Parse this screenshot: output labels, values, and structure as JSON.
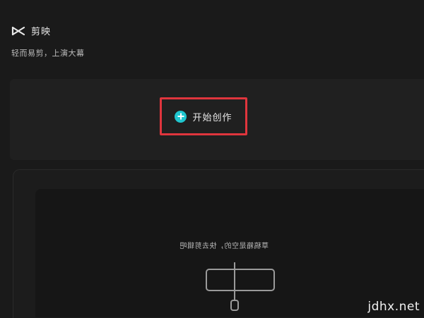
{
  "app": {
    "name": "剪映",
    "tagline": "轻而易剪，上演大幕",
    "logo_icon": "scissors-logo-icon"
  },
  "create_panel": {
    "button_label": "开始创作",
    "button_icon": "plus-circle-icon",
    "accent_color": "#20c6cf",
    "highlight_color": "#e0353d"
  },
  "drafts": {
    "empty_hint": "草稿箱是空的，快去剪辑吧",
    "illustration_icon": "empty-timeline-icon"
  },
  "watermark": "jdhx.net"
}
